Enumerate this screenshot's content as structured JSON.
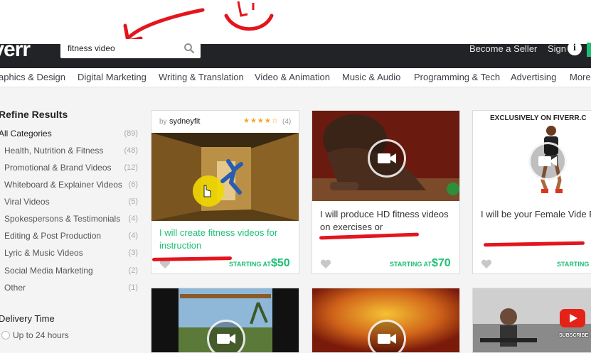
{
  "header": {
    "logo": "iverr",
    "search_value": "fitness video",
    "become_seller": "Become a Seller",
    "sign_in": "Sign",
    "info_icon": "info-icon"
  },
  "categories": [
    "aphics & Design",
    "Digital Marketing",
    "Writing & Translation",
    "Video & Animation",
    "Music & Audio",
    "Programming & Tech",
    "Advertising",
    "More"
  ],
  "sidebar": {
    "title": "Refine Results",
    "all": {
      "label": "All Categories",
      "count": "(89)"
    },
    "items": [
      {
        "label": "Health, Nutrition & Fitness",
        "count": "(48)"
      },
      {
        "label": "Promotional & Brand Videos",
        "count": "(12)"
      },
      {
        "label": "Whiteboard & Explainer Videos",
        "count": "(6)"
      },
      {
        "label": "Viral Videos",
        "count": "(5)"
      },
      {
        "label": "Spokespersons & Testimonials",
        "count": "(4)"
      },
      {
        "label": "Editing & Post Production",
        "count": "(4)"
      },
      {
        "label": "Lyric & Music Videos",
        "count": "(3)"
      },
      {
        "label": "Social Media Marketing",
        "count": "(2)"
      },
      {
        "label": "Other",
        "count": "(1)"
      }
    ],
    "delivery_title": "Delivery Time",
    "delivery_option": "Up to 24 hours"
  },
  "gigs": [
    {
      "by": "by",
      "seller": "sydneyfit",
      "rating_count": "(4)",
      "title": "I will create fitness videos for instruction",
      "starting_at": "STARTING AT",
      "price": "$50"
    },
    {
      "title": "I will produce HD fitness videos on exercises or",
      "starting_at": "STARTING AT",
      "price": "$70"
    },
    {
      "overlay": "EXCLUSIVELY ON FIVERR.C",
      "title": "I will be your Female Vide Fitness, Workout Sports o",
      "starting_at": "STARTING A"
    }
  ],
  "subscribe": "SUBSCRIBE"
}
